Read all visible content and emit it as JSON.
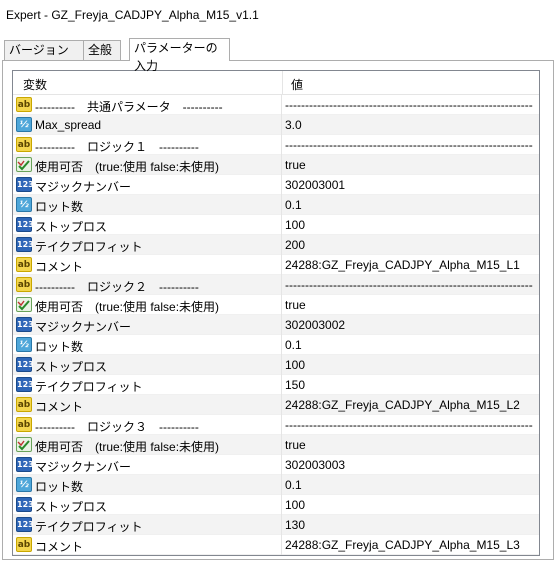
{
  "window": {
    "title": "Expert - GZ_Freyja_CADJPY_Alpha_M15_v1.1"
  },
  "tabs": [
    {
      "label": "バージョン情報"
    },
    {
      "label": "全般"
    },
    {
      "label": "パラメーターの入力"
    }
  ],
  "grid": {
    "col_name": "変数",
    "col_value": "値",
    "rows": [
      {
        "icon": "string-icon",
        "name": "----------　共通パラメータ　----------",
        "value": "--------------------------------------------------------------"
      },
      {
        "icon": "double-icon",
        "name": "Max_spread",
        "value": "3.0"
      },
      {
        "icon": "string-icon",
        "name": "----------　ロジック１　----------",
        "value": "--------------------------------------------------------------"
      },
      {
        "icon": "bool-icon",
        "name": "使用可否　(true:使用  false:未使用)",
        "value": "true"
      },
      {
        "icon": "int-icon",
        "name": "マジックナンバー",
        "value": "302003001"
      },
      {
        "icon": "double-icon",
        "name": "ロット数",
        "value": "0.1"
      },
      {
        "icon": "int-icon",
        "name": "ストップロス",
        "value": "100"
      },
      {
        "icon": "int-icon",
        "name": "テイクプロフィット",
        "value": "200"
      },
      {
        "icon": "string-icon",
        "name": "コメント",
        "value": "24288:GZ_Freyja_CADJPY_Alpha_M15_L1"
      },
      {
        "icon": "string-icon",
        "name": "----------　ロジック２　----------",
        "value": "--------------------------------------------------------------"
      },
      {
        "icon": "bool-icon",
        "name": "使用可否　(true:使用  false:未使用)",
        "value": "true"
      },
      {
        "icon": "int-icon",
        "name": "マジックナンバー",
        "value": "302003002"
      },
      {
        "icon": "double-icon",
        "name": "ロット数",
        "value": "0.1"
      },
      {
        "icon": "int-icon",
        "name": "ストップロス",
        "value": "100"
      },
      {
        "icon": "int-icon",
        "name": "テイクプロフィット",
        "value": "150"
      },
      {
        "icon": "string-icon",
        "name": "コメント",
        "value": "24288:GZ_Freyja_CADJPY_Alpha_M15_L2"
      },
      {
        "icon": "string-icon",
        "name": "----------　ロジック３　----------",
        "value": "--------------------------------------------------------------"
      },
      {
        "icon": "bool-icon",
        "name": "使用可否　(true:使用  false:未使用)",
        "value": "true"
      },
      {
        "icon": "int-icon",
        "name": "マジックナンバー",
        "value": "302003003"
      },
      {
        "icon": "double-icon",
        "name": "ロット数",
        "value": "0.1"
      },
      {
        "icon": "int-icon",
        "name": "ストップロス",
        "value": "100"
      },
      {
        "icon": "int-icon",
        "name": "テイクプロフィット",
        "value": "130"
      },
      {
        "icon": "string-icon",
        "name": "コメント",
        "value": "24288:GZ_Freyja_CADJPY_Alpha_M15_L3"
      }
    ]
  },
  "icon_glyphs": {
    "string-icon": "ab",
    "double-icon": "½",
    "int-icon": "123",
    "bool-icon": "✓"
  }
}
